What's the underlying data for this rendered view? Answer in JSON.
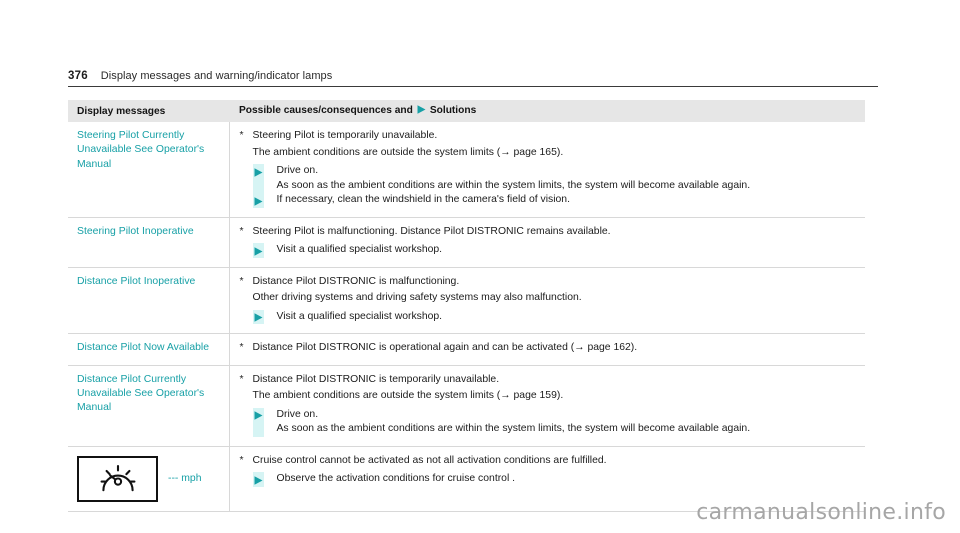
{
  "page": {
    "number": "376",
    "title": "Display messages and warning/indicator lamps",
    "watermark": "carmanualsonline.info"
  },
  "table": {
    "headers": {
      "col1": "Display messages",
      "col2_prefix": "Possible causes/consequences and",
      "col2_suffix": "Solutions"
    },
    "rows": [
      {
        "message": "Steering Pilot Currently Unavailable See Operator's Manual",
        "star": "*",
        "cause": "Steering Pilot is temporarily unavailable.",
        "continuation": "The ambient conditions are outside the system limits (→ page 165).",
        "solutions": [
          {
            "text": "Drive on.",
            "sub": "As soon as the ambient conditions are within the system limits, the system will become available again."
          },
          {
            "text": "If necessary, clean the windshield in the camera's field of vision.",
            "sub": ""
          }
        ],
        "icon": ""
      },
      {
        "message": "Steering Pilot Inoperative",
        "star": "*",
        "cause": "Steering Pilot is malfunctioning. Distance Pilot DISTRONIC remains available.",
        "continuation": "",
        "solutions": [
          {
            "text": "Visit a qualified specialist workshop.",
            "sub": ""
          }
        ],
        "icon": ""
      },
      {
        "message": "Distance Pilot Inoperative",
        "star": "*",
        "cause": "Distance Pilot DISTRONIC is malfunctioning.",
        "continuation": "Other driving systems and driving safety systems may also malfunction.",
        "solutions": [
          {
            "text": "Visit a qualified specialist workshop.",
            "sub": ""
          }
        ],
        "icon": ""
      },
      {
        "message": "Distance Pilot Now Available",
        "star": "*",
        "cause": "Distance Pilot DISTRONIC is operational again and can be activated (→ page 162).",
        "continuation": "",
        "solutions": [],
        "icon": ""
      },
      {
        "message": "Distance Pilot Currently Unavailable See Operator's Manual",
        "star": "*",
        "cause": "Distance Pilot DISTRONIC is temporarily unavailable.",
        "continuation": "The ambient conditions are outside the system limits (→ page 159).",
        "solutions": [
          {
            "text": "Drive on.",
            "sub": "As soon as the ambient conditions are within the system limits, the system will become available again."
          }
        ],
        "icon": ""
      },
      {
        "message": "",
        "star": "*",
        "cause": "Cruise control cannot be activated as not all activation conditions are fulfilled.",
        "continuation": "",
        "solutions": [
          {
            "text": "Observe the activation conditions for cruise control .",
            "sub": ""
          }
        ],
        "icon": "speedometer-icon",
        "icon_label": "--- mph"
      }
    ]
  },
  "colors": {
    "accent_teal": "#17a0a6",
    "solution_band": "#d6f4f4",
    "header_bg": "#e6e6e6",
    "border": "#d8d8d8"
  }
}
